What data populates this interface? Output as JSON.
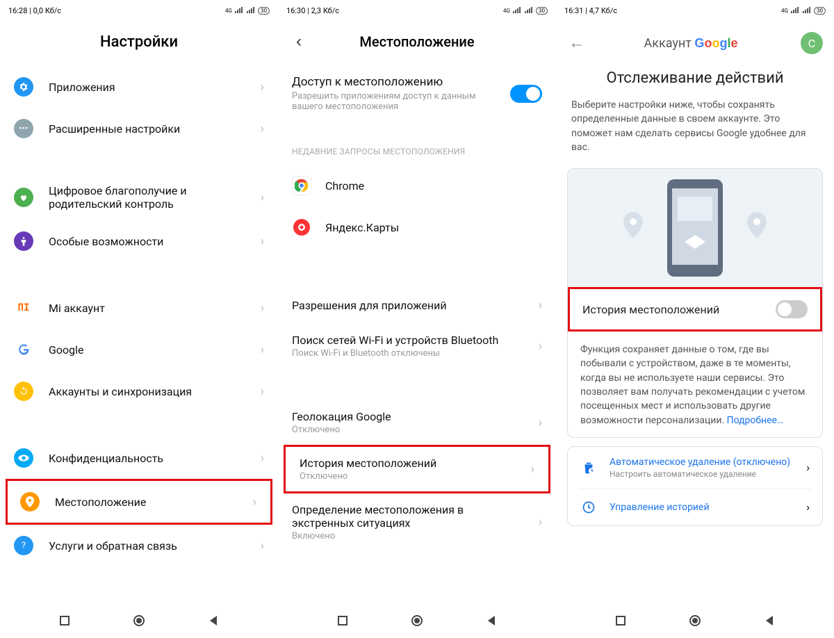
{
  "icons": {
    "battery": "30"
  },
  "screen1": {
    "status": {
      "time": "16:28",
      "speed": "0,0 Кб/с",
      "net": "4G"
    },
    "title": "Настройки",
    "items": {
      "apps": "Приложения",
      "advanced": "Расширенные настройки",
      "wellbeing1": "Цифровое благополучие и",
      "wellbeing2": "родительский контроль",
      "accessibility": "Особые возможности",
      "mi_account": "Mi аккаунт",
      "google": "Google",
      "accounts_sync": "Аккаунты и синхронизация",
      "privacy": "Конфиденциальность",
      "location": "Местоположение",
      "feedback": "Услуги и обратная связь"
    }
  },
  "screen2": {
    "status": {
      "time": "16:30",
      "speed": "2,3 Кб/с",
      "net": "4G"
    },
    "title": "Местоположение",
    "access_title": "Доступ к местоположению",
    "access_sub": "Разрешить приложениям доступ к данным вашего местоположения",
    "recent_header": "НЕДАВНИЕ ЗАПРОСЫ МЕСТОПОЛОЖЕНИЯ",
    "recent": {
      "chrome": "Chrome",
      "yandex": "Яндекс.Карты"
    },
    "app_perms": "Разрешения для приложений",
    "wifi_bt": "Поиск сетей Wi-Fi и устройств Bluetooth",
    "wifi_bt_sub": "Поиск Wi-Fi и Bluetooth отключены",
    "geo_google": "Геолокация Google",
    "geo_google_sub": "Отключено",
    "history": "История местоположений",
    "history_sub": "Отключено",
    "emergency1": "Определение местоположения в",
    "emergency2": "экстренных ситуациях",
    "emergency_sub": "Включено"
  },
  "screen3": {
    "status": {
      "time": "16:31",
      "speed": "4,7 Кб/с",
      "net": "4G"
    },
    "header_title": "Аккаунт",
    "avatar_letter": "С",
    "h2": "Отслеживание действий",
    "desc": "Выберите настройки ниже, чтобы сохранять определенные данные в своем аккаунте. Это поможет нам сделать сервисы Google удобнее для вас.",
    "history_label": "История местоположений",
    "body": "Функция сохраняет данные о том, где вы побывали с устройством, даже в те моменты, когда вы не используете наши сервисы. Это позволяет вам получать рекомендации с учетом посещенных мест и использовать другие возможности персонализации. ",
    "learn_more": "Подробнее…",
    "auto_del": "Автоматическое удаление (отключено)",
    "auto_del_sub": "Настроить автоматическое удаление",
    "manage": "Управление историей"
  }
}
